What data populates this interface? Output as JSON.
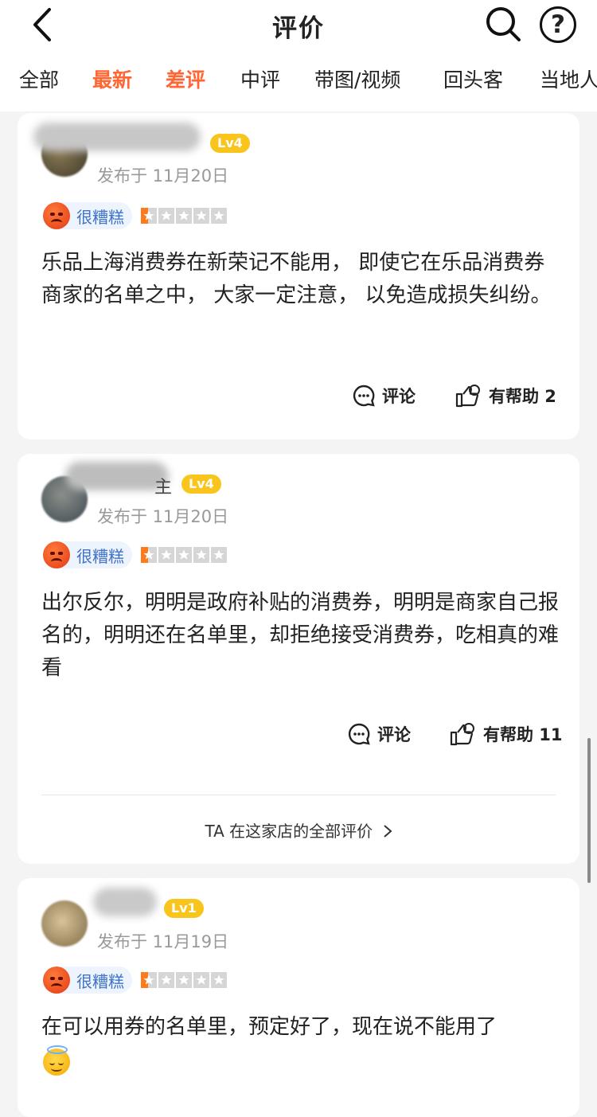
{
  "header": {
    "title": "评价"
  },
  "tabs": [
    {
      "label": "全部",
      "active": false
    },
    {
      "label": "最新",
      "active": true
    },
    {
      "label": "差评",
      "active": true
    },
    {
      "label": "中评",
      "active": false
    },
    {
      "label": "带图/视频",
      "active": false
    },
    {
      "label": "回头客",
      "active": false
    },
    {
      "label": "当地人",
      "active": false
    }
  ],
  "reviews": [
    {
      "username_partial": "",
      "level": "Lv4",
      "date": "发布于 11月20日",
      "rating_label": "很糟糕",
      "stars": 0.5,
      "text": "乐品上海消费券在新荣记不能用， 即使它在乐品消费券商家的名单之中， 大家一定注意， 以免造成损失纠纷。",
      "comment_label": "评论",
      "helpful_label": "有帮助 2"
    },
    {
      "username_partial": "主",
      "level": "Lv4",
      "date": "发布于 11月20日",
      "rating_label": "很糟糕",
      "stars": 0.5,
      "text": "出尔反尔，明明是政府补贴的消费券，明明是商家自己报名的，明明还在名单里，却拒绝接受消费券，吃相真的难看",
      "comment_label": "评论",
      "helpful_label": "有帮助 11",
      "all_reviews_link": "TA 在这家店的全部评价"
    },
    {
      "username_partial": "",
      "level": "Lv1",
      "date": "发布于 11月19日",
      "rating_label": "很糟糕",
      "stars": 0.5,
      "text": "在可以用券的名单里，预定好了，现在说不能用了"
    }
  ],
  "icons": {
    "back": "chevron-left-icon",
    "search": "search-icon",
    "help": "question-icon",
    "comment": "comment-icon",
    "helpful": "thumb-icon",
    "rating": "angry-face-icon",
    "emoji": "angel-smile-icon"
  },
  "colors": {
    "accent": "#ff6633",
    "level": "#f9c51c",
    "rating_text": "#3f73c6",
    "star": "#ff7a1a"
  }
}
